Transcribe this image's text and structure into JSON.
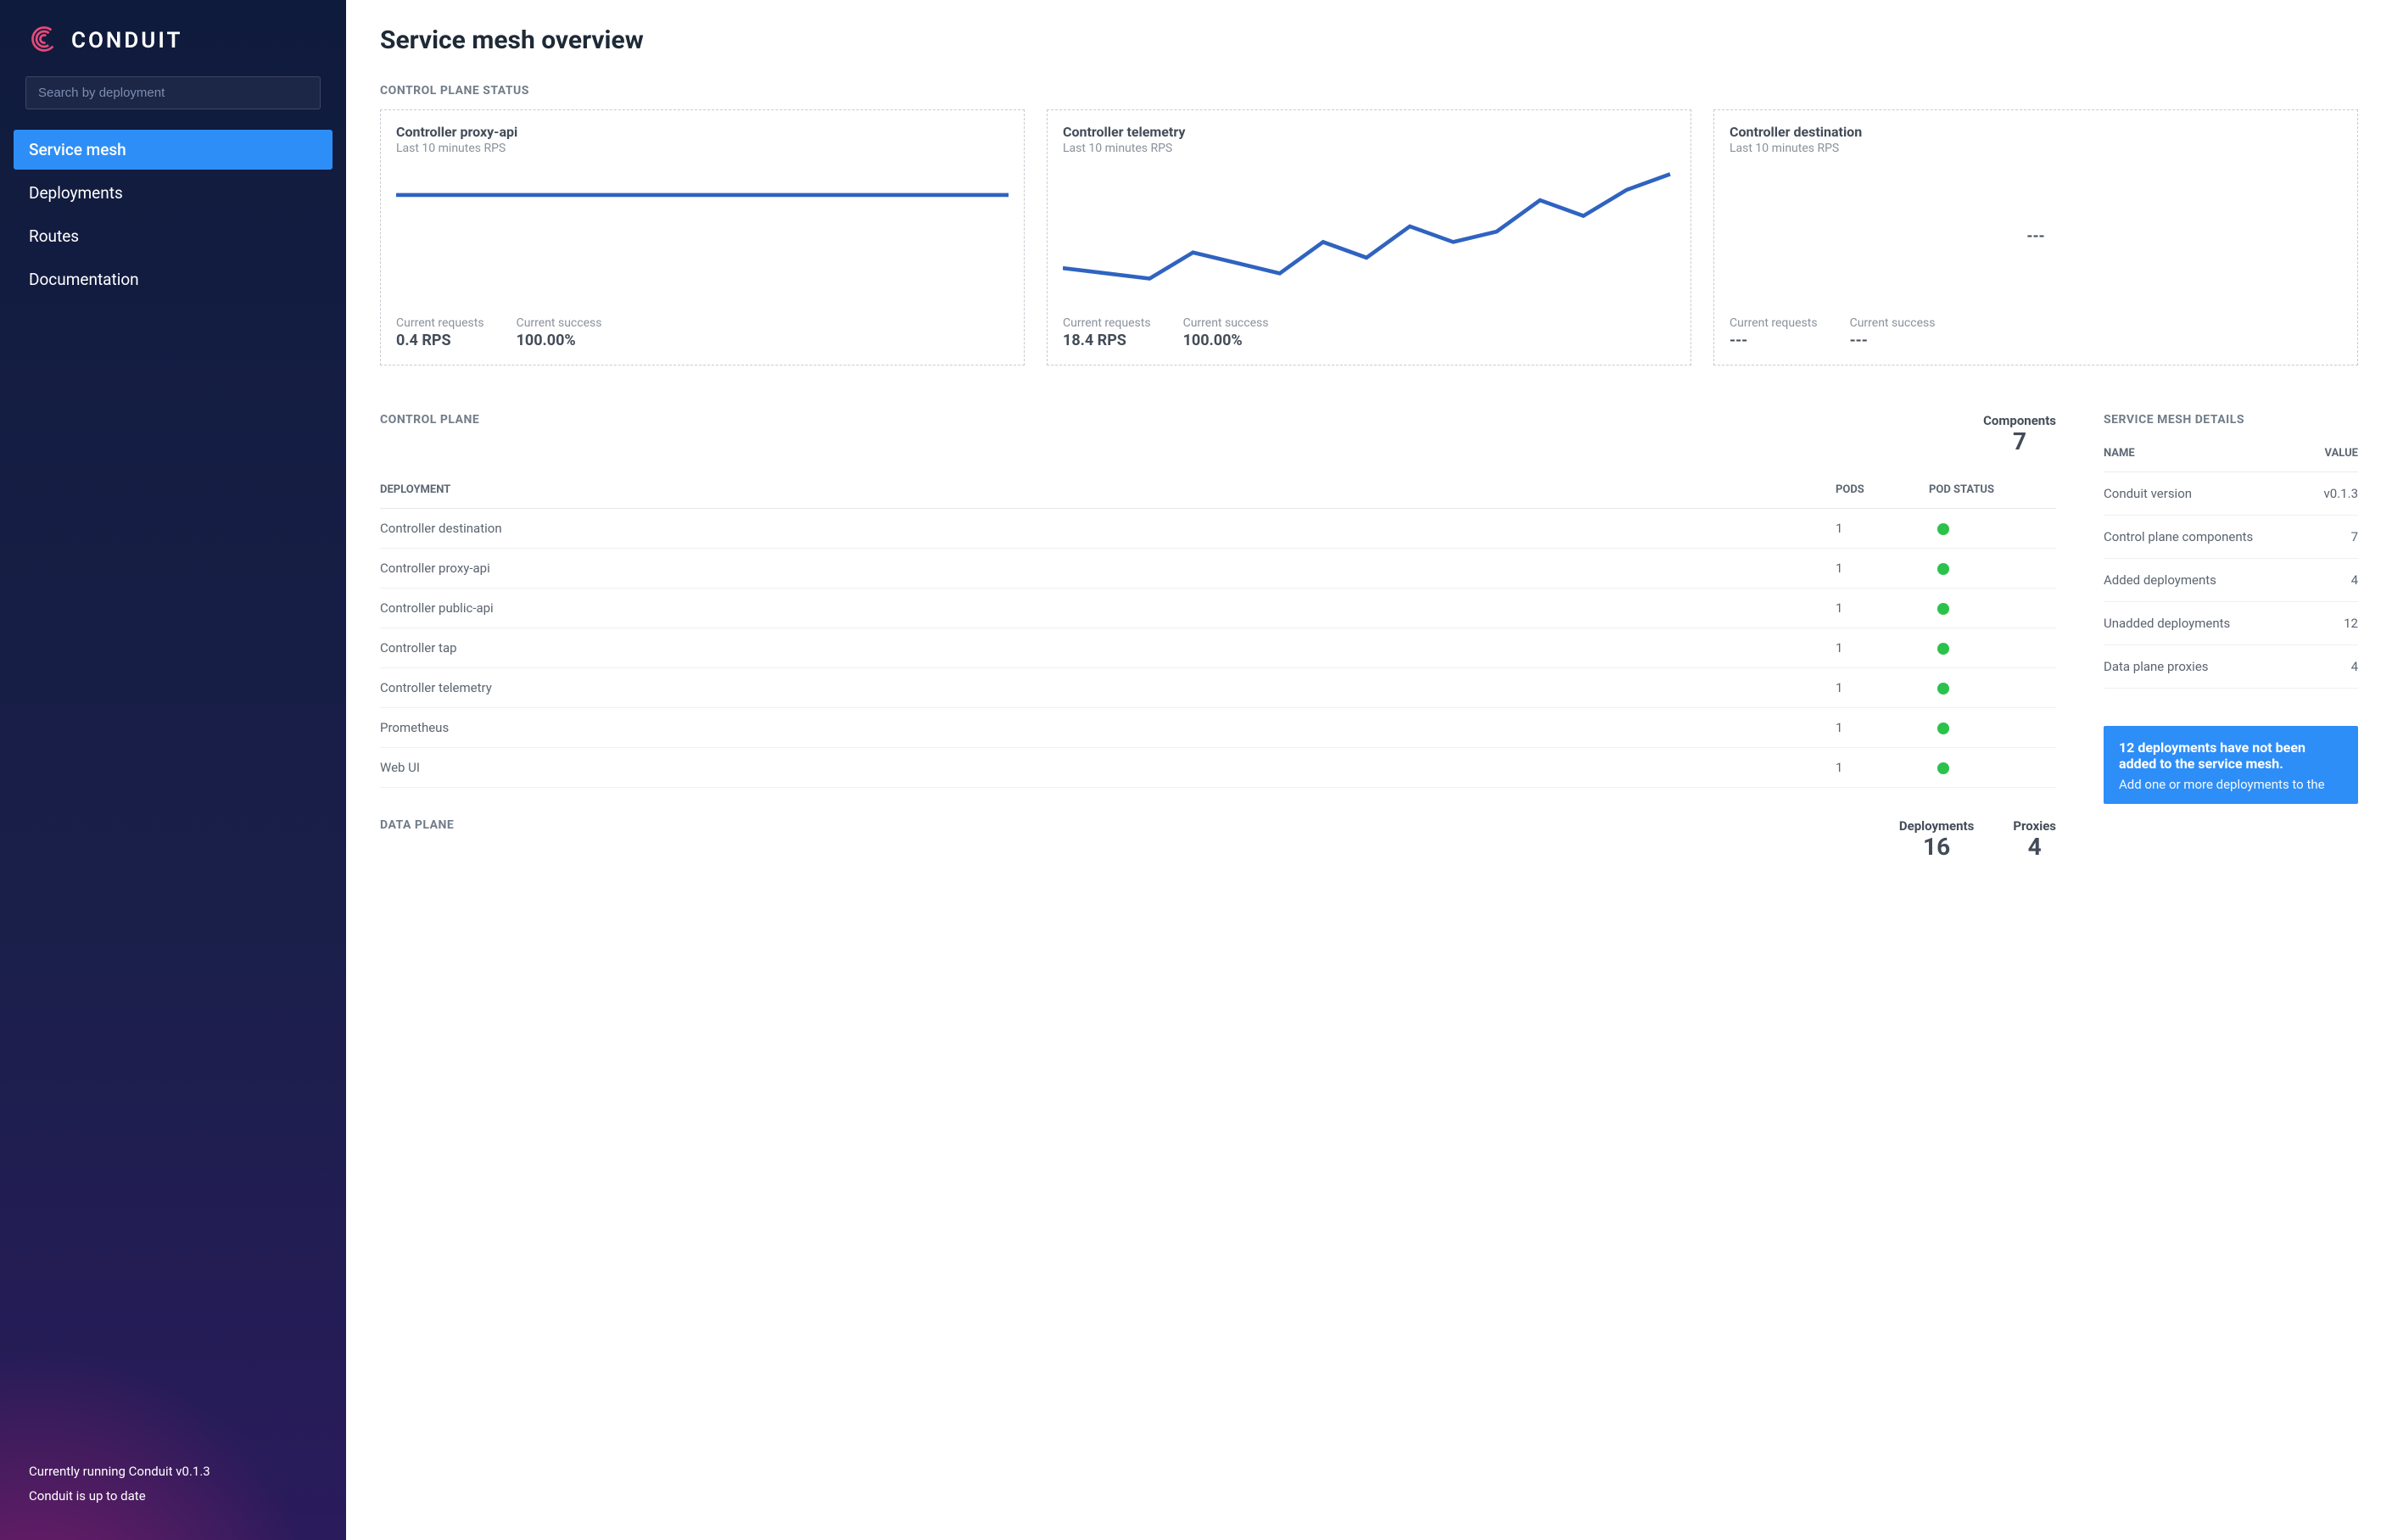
{
  "brand": {
    "name": "CONDUIT"
  },
  "search": {
    "placeholder": "Search by deployment"
  },
  "nav": {
    "items": [
      {
        "label": "Service mesh",
        "active": true
      },
      {
        "label": "Deployments",
        "active": false
      },
      {
        "label": "Routes",
        "active": false
      },
      {
        "label": "Documentation",
        "active": false
      }
    ]
  },
  "sidebar_footer": {
    "line1": "Currently running Conduit v0.1.3",
    "line2": "Conduit is up to date"
  },
  "page_title": "Service mesh overview",
  "status": {
    "heading": "CONTROL PLANE STATUS",
    "metric_labels": {
      "requests": "Current requests",
      "success": "Current success"
    },
    "cards": [
      {
        "title": "Controller proxy-api",
        "subtitle": "Last 10 minutes RPS",
        "requests": "0.4 RPS",
        "success": "100.00%",
        "series": "flat"
      },
      {
        "title": "Controller telemetry",
        "subtitle": "Last 10 minutes RPS",
        "requests": "18.4 RPS",
        "success": "100.00%",
        "series": "wavy"
      },
      {
        "title": "Controller destination",
        "subtitle": "Last 10 minutes RPS",
        "requests": "---",
        "success": "---",
        "series": "none",
        "placeholder": "---"
      }
    ]
  },
  "control_plane": {
    "heading": "CONTROL PLANE",
    "components_label": "Components",
    "components_count": "7",
    "columns": {
      "deployment": "DEPLOYMENT",
      "pods": "PODS",
      "status": "POD STATUS"
    },
    "rows": [
      {
        "name": "Controller destination",
        "pods": "1",
        "status": "green"
      },
      {
        "name": "Controller proxy-api",
        "pods": "1",
        "status": "green"
      },
      {
        "name": "Controller public-api",
        "pods": "1",
        "status": "green"
      },
      {
        "name": "Controller tap",
        "pods": "1",
        "status": "green"
      },
      {
        "name": "Controller telemetry",
        "pods": "1",
        "status": "green"
      },
      {
        "name": "Prometheus",
        "pods": "1",
        "status": "green"
      },
      {
        "name": "Web UI",
        "pods": "1",
        "status": "green"
      }
    ]
  },
  "data_plane": {
    "heading": "DATA PLANE",
    "counts": [
      {
        "label": "Deployments",
        "value": "16"
      },
      {
        "label": "Proxies",
        "value": "4"
      }
    ]
  },
  "details": {
    "heading": "SERVICE MESH DETAILS",
    "columns": {
      "name": "NAME",
      "value": "VALUE"
    },
    "rows": [
      {
        "name": "Conduit version",
        "value": "v0.1.3"
      },
      {
        "name": "Control plane components",
        "value": "7"
      },
      {
        "name": "Added deployments",
        "value": "4"
      },
      {
        "name": "Unadded deployments",
        "value": "12"
      },
      {
        "name": "Data plane proxies",
        "value": "4"
      }
    ]
  },
  "toast": {
    "title": "12 deployments have not been added to the service mesh.",
    "body": "Add one or more deployments to the"
  },
  "chart_data": [
    {
      "type": "line",
      "title": "Controller proxy-api",
      "ylabel": "RPS",
      "x": [
        0,
        1,
        2,
        3,
        4,
        5,
        6,
        7,
        8,
        9
      ],
      "values": [
        0.4,
        0.4,
        0.4,
        0.4,
        0.4,
        0.4,
        0.4,
        0.4,
        0.4,
        0.4
      ]
    },
    {
      "type": "line",
      "title": "Controller telemetry",
      "ylabel": "RPS",
      "x": [
        0,
        1,
        2,
        3,
        4,
        5,
        6,
        7,
        8,
        9,
        10,
        11,
        12,
        13,
        14
      ],
      "values": [
        16,
        15.5,
        15,
        17,
        16,
        15.5,
        17.5,
        16.5,
        18,
        17,
        18,
        19.5,
        18.5,
        20,
        21
      ]
    },
    {
      "type": "line",
      "title": "Controller destination",
      "ylabel": "RPS",
      "x": [],
      "values": []
    }
  ]
}
